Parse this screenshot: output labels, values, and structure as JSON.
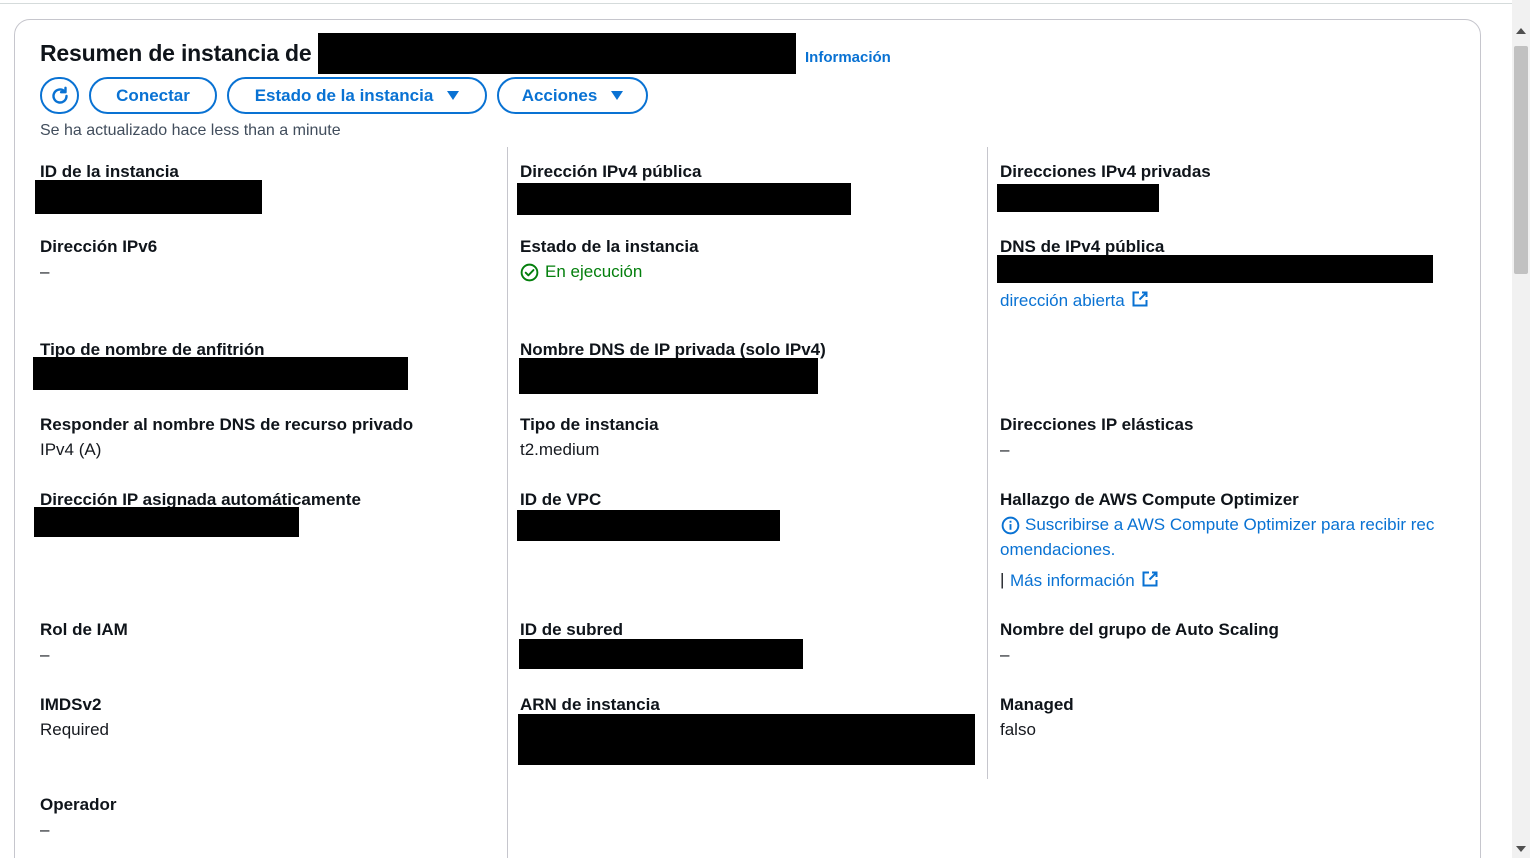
{
  "header": {
    "title": "Resumen de instancia de",
    "info_link": "Información",
    "updated_text": "Se ha actualizado hace less than a minute"
  },
  "toolbar": {
    "connect_label": "Conectar",
    "instance_state_label": "Estado de la instancia",
    "actions_label": "Acciones"
  },
  "details": {
    "instance_id": {
      "label": "ID de la instancia"
    },
    "ipv6": {
      "label": "Dirección IPv6",
      "value": "–"
    },
    "hostname_type": {
      "label": "Tipo de nombre de anfitrión"
    },
    "respond_dns": {
      "label": "Responder al nombre DNS de recurso privado",
      "value": "IPv4 (A)"
    },
    "auto_ip": {
      "label": "Dirección IP asignada automáticamente"
    },
    "iam_role": {
      "label": "Rol de IAM",
      "value": "–"
    },
    "imdsv2": {
      "label": "IMDSv2",
      "value": "Required"
    },
    "operator": {
      "label": "Operador",
      "value": "–"
    },
    "public_ipv4": {
      "label": "Dirección IPv4 pública"
    },
    "instance_state": {
      "label": "Estado de la instancia",
      "value": "En ejecución"
    },
    "private_dns": {
      "label": "Nombre DNS de IP privada (solo IPv4)"
    },
    "instance_type": {
      "label": "Tipo de instancia",
      "value": "t2.medium"
    },
    "vpc_id": {
      "label": "ID de VPC"
    },
    "subnet_id": {
      "label": "ID de subred"
    },
    "instance_arn": {
      "label": "ARN de instancia"
    },
    "private_ipv4": {
      "label": "Direcciones IPv4 privadas"
    },
    "public_dns": {
      "label": "DNS de IPv4 pública",
      "link": "dirección abierta"
    },
    "elastic_ip": {
      "label": "Direcciones IP elásticas",
      "value": "–"
    },
    "optimizer": {
      "label": "Hallazgo de AWS Compute Optimizer",
      "link_line1": "Suscribirse a AWS Compute Optimizer para recibir rec",
      "link_line2": "omendaciones.",
      "separator": "|",
      "more_info": "Más información"
    },
    "asg_name": {
      "label": "Nombre del grupo de Auto Scaling",
      "value": "–"
    },
    "managed": {
      "label": "Managed",
      "value": "falso"
    }
  },
  "colors": {
    "accent": "#0972d3",
    "success": "#037f0c",
    "border": "#c6c6cd"
  }
}
